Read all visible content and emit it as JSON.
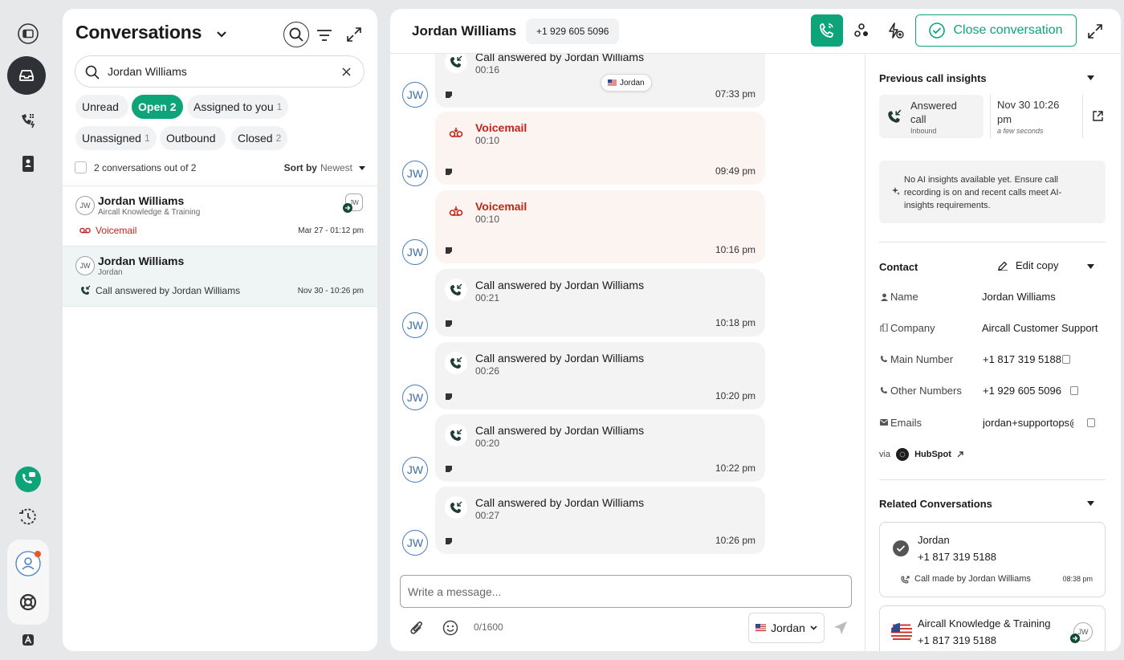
{
  "rail": {
    "accent": "#0ea47a",
    "icons": [
      "sidebar-toggle-icon",
      "inbox-icon",
      "power-dialer-icon",
      "contacts-book-icon",
      "phone-chat-icon",
      "history-icon",
      "user-icon",
      "lifebuoy-icon",
      "aircall-logo-icon"
    ]
  },
  "conversations": {
    "title": "Conversations",
    "search_value": "Jordan Williams",
    "filters": [
      {
        "label": "Unread",
        "count": ""
      },
      {
        "label": "Open",
        "count": "2"
      },
      {
        "label": "Assigned to you",
        "count": "1"
      },
      {
        "label": "Unassigned",
        "count": "1"
      },
      {
        "label": "Outbound",
        "count": ""
      },
      {
        "label": "Closed",
        "count": "2"
      }
    ],
    "count_text": "2 conversations out of 2",
    "sort_label": "Sort by",
    "sort_value": "Newest",
    "items": [
      {
        "initials": "JW",
        "name": "Jordan Williams",
        "sub": "Aircall Knowledge & Training",
        "last": "Voicemail",
        "time": "Mar 27 - 01:12 pm",
        "assignee": "JW"
      },
      {
        "initials": "JW",
        "name": "Jordan Williams",
        "sub": "Jordan",
        "last": "Call answered by Jordan Williams",
        "time": "Nov 30 - 10:26 pm"
      }
    ]
  },
  "header": {
    "contact_name": "Jordan Williams",
    "contact_phone": "+1 929 605 5096",
    "close_label": "Close conversation"
  },
  "messages": {
    "avatar": "JW",
    "tag_label": "Jordan",
    "items": [
      {
        "title": "Call answered by Jordan Williams",
        "duration": "00:16",
        "time": "07:33 pm",
        "type": "call"
      },
      {
        "title": "Voicemail",
        "duration": "00:10",
        "time": "09:49 pm",
        "type": "voicemail"
      },
      {
        "title": "Voicemail",
        "duration": "00:10",
        "time": "10:16 pm",
        "type": "voicemail"
      },
      {
        "title": "Call answered by Jordan Williams",
        "duration": "00:21",
        "time": "10:18 pm",
        "type": "call"
      },
      {
        "title": "Call answered by Jordan Williams",
        "duration": "00:26",
        "time": "10:20 pm",
        "type": "call"
      },
      {
        "title": "Call answered by Jordan Williams",
        "duration": "00:20",
        "time": "10:22 pm",
        "type": "call"
      },
      {
        "title": "Call answered by Jordan Williams",
        "duration": "00:27",
        "time": "10:26 pm",
        "type": "call"
      }
    ]
  },
  "composer": {
    "placeholder": "Write a message...",
    "char_count": "0/1600",
    "line_label": "Jordan"
  },
  "insights": {
    "title": "Previous call insights",
    "call_status_1": "Answered",
    "call_status_2": "call",
    "call_direction": "Inbound",
    "date_1": "Nov 30 10:26",
    "date_2": "pm",
    "relative": "a few seconds",
    "ai_message": "No AI insights available yet. Ensure call recording is on and recent calls meet AI-insights requirements."
  },
  "contact": {
    "title": "Contact",
    "edit_label": "Edit copy",
    "fields": [
      {
        "label": "Name",
        "value": "Jordan Williams"
      },
      {
        "label": "Company",
        "value": "Aircall Customer Support"
      },
      {
        "label": "Main Number",
        "value": "+1 817 319 5188"
      },
      {
        "label": "Other Numbers",
        "value": "+1 929 605 5096"
      },
      {
        "label": "Emails",
        "value": "jordan+supportops@aircall.io"
      }
    ],
    "via_label": "via",
    "source": "HubSpot"
  },
  "related": {
    "title": "Related Conversations",
    "items": [
      {
        "name": "Jordan",
        "phone": "+1 817 319 5188",
        "last": "Call made by Jordan Williams",
        "time": "08:38 pm"
      },
      {
        "name": "Aircall Knowledge & Training",
        "phone": "+1 817 319 5188",
        "assignee": "JW"
      }
    ]
  }
}
